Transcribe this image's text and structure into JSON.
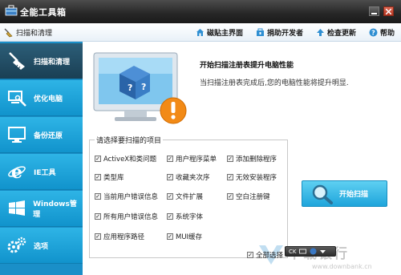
{
  "window": {
    "title": "全能工具箱"
  },
  "toolbar": {
    "breadcrumb": "扫描和清理",
    "links": [
      {
        "label": "磁贴主界面",
        "icon": "home-icon"
      },
      {
        "label": "捐助开发者",
        "icon": "donate-icon"
      },
      {
        "label": "检查更新",
        "icon": "update-arrow-icon"
      },
      {
        "label": "帮助",
        "icon": "help-icon"
      }
    ]
  },
  "sidebar": {
    "items": [
      {
        "label": "扫描和清理",
        "icon": "broom-icon",
        "active": true
      },
      {
        "label": "优化电脑",
        "icon": "computer-tools-icon",
        "active": false
      },
      {
        "label": "备份还原",
        "icon": "monitor-icon",
        "active": false
      },
      {
        "label": "IE工具",
        "icon": "ie-icon",
        "active": false
      },
      {
        "label": "Windows管理",
        "icon": "windows-icon",
        "active": false
      },
      {
        "label": "选项",
        "icon": "gears-icon",
        "active": false
      }
    ]
  },
  "main": {
    "banner_title": "开始扫描注册表提升电脑性能",
    "banner_desc": "当扫描注册表完成后,您的电脑性能将提升明显.",
    "group_title": "请选择要扫描的项目",
    "checkboxes": [
      {
        "label": "ActiveX和类问题",
        "checked": true
      },
      {
        "label": "用户程序菜单",
        "checked": true
      },
      {
        "label": "添加删除程序",
        "checked": true
      },
      {
        "label": "类型库",
        "checked": true
      },
      {
        "label": "收藏夹次序",
        "checked": true
      },
      {
        "label": "无效安装程序",
        "checked": true
      },
      {
        "label": "当前用户错误信息",
        "checked": true
      },
      {
        "label": "文件扩展",
        "checked": true
      },
      {
        "label": "空白注册键",
        "checked": true
      },
      {
        "label": "所有用户错误信息",
        "checked": true
      },
      {
        "label": "系统字体",
        "checked": true
      },
      {
        "label": "应用程序路径",
        "checked": true
      },
      {
        "label": "MUI缓存",
        "checked": true
      }
    ],
    "select_all": {
      "label": "全部选择",
      "checked": true
    },
    "scan_button": "开始扫描"
  },
  "watermark": {
    "text": "下载银行",
    "url": "www.downbank.cn"
  },
  "ime": {
    "label": "CK"
  },
  "colors": {
    "sidebar_blue": "#1a8fc8",
    "sidebar_active": "#1a3f54",
    "scan_button": "#1fa5db",
    "titlebar": "#262626"
  }
}
